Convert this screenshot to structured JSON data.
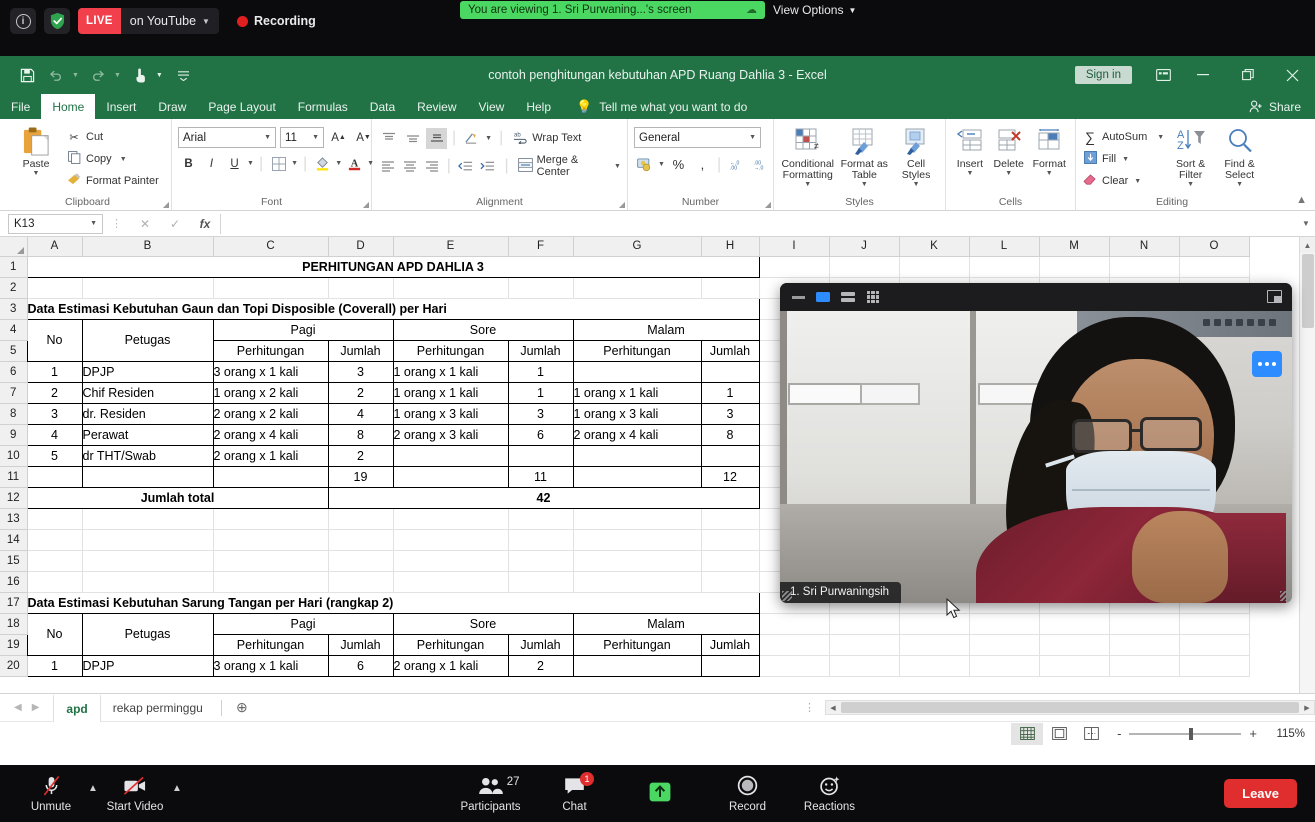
{
  "zoom_topbar": {
    "info_icon": "info-icon",
    "shield_icon": "security-shield-icon",
    "live_label": "LIVE",
    "platform_label": "on YouTube",
    "recording_label": "Recording",
    "viewing_banner": "You are viewing 1.  Sri Purwaning...'s screen",
    "cloud_icon": "cloud-icon",
    "view_options_label": "View Options",
    "banner_color": "#4ad863"
  },
  "excel": {
    "title": "contoh penghitungan kebutuhan APD Ruang Dahlia 3  -  Excel",
    "sign_in_label": "Sign in",
    "share_label": "Share",
    "quick_access": [
      "save-icon",
      "undo-icon",
      "redo-icon",
      "touch-mode-icon",
      "customize-qat-icon"
    ],
    "window_buttons": [
      "ribbon-display-options-icon",
      "minimize-icon",
      "restore-icon",
      "close-icon"
    ],
    "tabs": [
      {
        "label": "File",
        "active": false
      },
      {
        "label": "Home",
        "active": true
      },
      {
        "label": "Insert",
        "active": false
      },
      {
        "label": "Draw",
        "active": false
      },
      {
        "label": "Page Layout",
        "active": false
      },
      {
        "label": "Formulas",
        "active": false
      },
      {
        "label": "Data",
        "active": false
      },
      {
        "label": "Review",
        "active": false
      },
      {
        "label": "View",
        "active": false
      },
      {
        "label": "Help",
        "active": false
      }
    ],
    "tell_me": "Tell me what you want to do",
    "ribbon": {
      "clipboard": {
        "label": "Clipboard",
        "paste": "Paste",
        "cut": "Cut",
        "copy": "Copy",
        "format_painter": "Format Painter"
      },
      "font": {
        "label": "Font",
        "font_name": "Arial",
        "font_size": "11",
        "bold": "B",
        "italic": "I",
        "underline": "U"
      },
      "alignment": {
        "label": "Alignment",
        "wrap_text": "Wrap Text",
        "merge_center": "Merge & Center"
      },
      "number": {
        "label": "Number",
        "format": "General",
        "percent": "%",
        "comma": ","
      },
      "styles": {
        "label": "Styles",
        "conditional_formatting": "Conditional Formatting",
        "format_as_table": "Format as Table",
        "cell_styles": "Cell Styles"
      },
      "cells": {
        "label": "Cells",
        "insert": "Insert",
        "delete": "Delete",
        "format": "Format"
      },
      "editing": {
        "label": "Editing",
        "autosum": "AutoSum",
        "fill": "Fill",
        "clear": "Clear",
        "sort_filter": "Sort & Filter",
        "find_select": "Find & Select"
      }
    },
    "formula_bar": {
      "name_box": "K13",
      "cancel_icon": "cancel-icon",
      "enter_icon": "enter-icon",
      "function_icon": "insert-function-icon",
      "formula_value": ""
    },
    "grid": {
      "columns": [
        "A",
        "B",
        "C",
        "D",
        "E",
        "F",
        "G",
        "H",
        "I",
        "J",
        "K",
        "L",
        "M",
        "N",
        "O"
      ],
      "rows": [
        {
          "n": "1",
          "cells": [
            {
              "c": "A",
              "span": 8,
              "text": "PERHITUNGAN APD DAHLIA 3",
              "align": "center",
              "bold": true
            }
          ]
        },
        {
          "n": "2",
          "cells": []
        },
        {
          "n": "3",
          "cells": [
            {
              "c": "A",
              "span": 8,
              "text": "Data Estimasi Kebutuhan Gaun dan Topi Disposible (Coverall)  per Hari",
              "align": "left",
              "bold": true
            }
          ]
        },
        {
          "n": "4",
          "cells": [
            {
              "c": "A",
              "text": "No",
              "align": "center",
              "rowspan": 2
            },
            {
              "c": "B",
              "text": "Petugas",
              "align": "center",
              "rowspan": 2
            },
            {
              "c": "C",
              "span": 2,
              "text": "Pagi",
              "align": "center"
            },
            {
              "c": "E",
              "span": 2,
              "text": "Sore",
              "align": "center"
            },
            {
              "c": "G",
              "span": 2,
              "text": "Malam",
              "align": "center"
            }
          ]
        },
        {
          "n": "5",
          "cells": [
            {
              "c": "C",
              "text": "Perhitungan",
              "align": "center"
            },
            {
              "c": "D",
              "text": "Jumlah",
              "align": "center"
            },
            {
              "c": "E",
              "text": "Perhitungan",
              "align": "center"
            },
            {
              "c": "F",
              "text": "Jumlah",
              "align": "center"
            },
            {
              "c": "G",
              "text": "Perhitungan",
              "align": "center"
            },
            {
              "c": "H",
              "text": "Jumlah",
              "align": "center"
            }
          ]
        },
        {
          "n": "6",
          "cells": [
            {
              "c": "A",
              "text": "1",
              "align": "center"
            },
            {
              "c": "B",
              "text": "DPJP",
              "align": "left"
            },
            {
              "c": "C",
              "text": "3 orang x 1 kali",
              "align": "left"
            },
            {
              "c": "D",
              "text": "3",
              "align": "center"
            },
            {
              "c": "E",
              "text": "1 orang x 1 kali",
              "align": "left"
            },
            {
              "c": "F",
              "text": "1",
              "align": "center"
            },
            {
              "c": "G",
              "text": "",
              "align": "left"
            },
            {
              "c": "H",
              "text": "",
              "align": "center"
            }
          ]
        },
        {
          "n": "7",
          "cells": [
            {
              "c": "A",
              "text": "2",
              "align": "center"
            },
            {
              "c": "B",
              "text": "Chif Residen",
              "align": "left"
            },
            {
              "c": "C",
              "text": "1 orang x 2 kali",
              "align": "left"
            },
            {
              "c": "D",
              "text": "2",
              "align": "center"
            },
            {
              "c": "E",
              "text": "1 orang x 1 kali",
              "align": "left"
            },
            {
              "c": "F",
              "text": "1",
              "align": "center"
            },
            {
              "c": "G",
              "text": "1 orang x 1 kali",
              "align": "left"
            },
            {
              "c": "H",
              "text": "1",
              "align": "center"
            }
          ]
        },
        {
          "n": "8",
          "cells": [
            {
              "c": "A",
              "text": "3",
              "align": "center"
            },
            {
              "c": "B",
              "text": "dr. Residen",
              "align": "left"
            },
            {
              "c": "C",
              "text": "2 orang x 2 kali",
              "align": "left"
            },
            {
              "c": "D",
              "text": "4",
              "align": "center"
            },
            {
              "c": "E",
              "text": "1 orang x 3 kali",
              "align": "left"
            },
            {
              "c": "F",
              "text": "3",
              "align": "center"
            },
            {
              "c": "G",
              "text": "1 orang x 3 kali",
              "align": "left"
            },
            {
              "c": "H",
              "text": "3",
              "align": "center"
            }
          ]
        },
        {
          "n": "9",
          "cells": [
            {
              "c": "A",
              "text": "4",
              "align": "center"
            },
            {
              "c": "B",
              "text": "Perawat",
              "align": "left"
            },
            {
              "c": "C",
              "text": "2 orang x 4 kali",
              "align": "left"
            },
            {
              "c": "D",
              "text": "8",
              "align": "center"
            },
            {
              "c": "E",
              "text": "2 orang x 3 kali",
              "align": "left"
            },
            {
              "c": "F",
              "text": "6",
              "align": "center"
            },
            {
              "c": "G",
              "text": "2 orang x 4 kali",
              "align": "left"
            },
            {
              "c": "H",
              "text": "8",
              "align": "center"
            }
          ]
        },
        {
          "n": "10",
          "cells": [
            {
              "c": "A",
              "text": "5",
              "align": "center"
            },
            {
              "c": "B",
              "text": "dr THT/Swab",
              "align": "left"
            },
            {
              "c": "C",
              "text": "2 orang x 1 kali",
              "align": "left"
            },
            {
              "c": "D",
              "text": "2",
              "align": "center"
            },
            {
              "c": "E",
              "text": "",
              "align": "left"
            },
            {
              "c": "F",
              "text": "",
              "align": "center"
            },
            {
              "c": "G",
              "text": "",
              "align": "left"
            },
            {
              "c": "H",
              "text": "",
              "align": "center"
            }
          ]
        },
        {
          "n": "11",
          "cells": [
            {
              "c": "A",
              "text": "",
              "align": "center"
            },
            {
              "c": "B",
              "text": "",
              "align": "left"
            },
            {
              "c": "C",
              "text": "",
              "align": "left"
            },
            {
              "c": "D",
              "text": "19",
              "align": "center"
            },
            {
              "c": "E",
              "text": "",
              "align": "left"
            },
            {
              "c": "F",
              "text": "11",
              "align": "center"
            },
            {
              "c": "G",
              "text": "",
              "align": "left"
            },
            {
              "c": "H",
              "text": "12",
              "align": "center"
            }
          ]
        },
        {
          "n": "12",
          "cells": [
            {
              "c": "A",
              "span": 3,
              "text": "Jumlah total",
              "align": "center",
              "bold": true
            },
            {
              "c": "D",
              "span": 5,
              "text": "42",
              "align": "center",
              "bold": true
            }
          ]
        },
        {
          "n": "13",
          "cells": []
        },
        {
          "n": "14",
          "cells": []
        },
        {
          "n": "15",
          "cells": []
        },
        {
          "n": "16",
          "cells": []
        },
        {
          "n": "17",
          "cells": [
            {
              "c": "A",
              "span": 8,
              "text": "Data Estimasi Kebutuhan Sarung Tangan per Hari  (rangkap 2)",
              "align": "left",
              "bold": true
            }
          ]
        },
        {
          "n": "18",
          "cells": [
            {
              "c": "A",
              "text": "No",
              "align": "center",
              "rowspan": 2
            },
            {
              "c": "B",
              "text": "Petugas",
              "align": "center",
              "rowspan": 2
            },
            {
              "c": "C",
              "span": 2,
              "text": "Pagi",
              "align": "center"
            },
            {
              "c": "E",
              "span": 2,
              "text": "Sore",
              "align": "center"
            },
            {
              "c": "G",
              "span": 2,
              "text": "Malam",
              "align": "center"
            }
          ]
        },
        {
          "n": "19",
          "cells": [
            {
              "c": "C",
              "text": "Perhitungan",
              "align": "center"
            },
            {
              "c": "D",
              "text": "Jumlah",
              "align": "center"
            },
            {
              "c": "E",
              "text": "Perhitungan",
              "align": "center"
            },
            {
              "c": "F",
              "text": "Jumlah",
              "align": "center"
            },
            {
              "c": "G",
              "text": "Perhitungan",
              "align": "center"
            },
            {
              "c": "H",
              "text": "Jumlah",
              "align": "center"
            }
          ]
        },
        {
          "n": "20",
          "cells": [
            {
              "c": "A",
              "text": "1",
              "align": "center"
            },
            {
              "c": "B",
              "text": "DPJP",
              "align": "left"
            },
            {
              "c": "C",
              "text": "3 orang x 1 kali",
              "align": "left"
            },
            {
              "c": "D",
              "text": "6",
              "align": "center"
            },
            {
              "c": "E",
              "text": "2 orang x 1 kali",
              "align": "left"
            },
            {
              "c": "F",
              "text": "2",
              "align": "center"
            },
            {
              "c": "G",
              "text": "",
              "align": "left"
            },
            {
              "c": "H",
              "text": "",
              "align": "center"
            }
          ]
        }
      ]
    },
    "sheet_tabs": [
      {
        "label": "apd",
        "active": true
      },
      {
        "label": "rekap perminggu",
        "active": false
      }
    ],
    "add_sheet_icon": "add-sheet-icon",
    "status": {
      "view_normal_icon": "normal-view-icon",
      "view_layout_icon": "page-layout-view-icon",
      "view_break_icon": "page-break-view-icon",
      "zoom_out": "-",
      "zoom_in": "+",
      "zoom_level": "115%"
    }
  },
  "video_panel": {
    "toolbar_icons": [
      "minimize-icon",
      "active-speaker-view-icon",
      "filmstrip-view-icon",
      "gallery-view-icon",
      "popout-icon"
    ],
    "more_options_icon": "more-options-icon",
    "participant_name": "1.  Sri Purwaningsih"
  },
  "zoom_bottombar": {
    "items": [
      {
        "name": "unmute",
        "label": "Unmute",
        "icon": "microphone-muted-icon",
        "caret": true
      },
      {
        "name": "start-video",
        "label": "Start Video",
        "icon": "camera-off-icon",
        "caret": true
      },
      {
        "name": "participants",
        "label": "Participants",
        "icon": "participants-icon",
        "count": "27"
      },
      {
        "name": "chat",
        "label": "Chat",
        "icon": "chat-icon",
        "badge": "1"
      },
      {
        "name": "share-screen",
        "label": "Share Screen",
        "icon": "share-screen-icon",
        "green": true
      },
      {
        "name": "record",
        "label": "Record",
        "icon": "record-icon"
      },
      {
        "name": "reactions",
        "label": "Reactions",
        "icon": "reactions-icon"
      }
    ],
    "leave_label": "Leave",
    "leave_color": "#e02d2d"
  }
}
